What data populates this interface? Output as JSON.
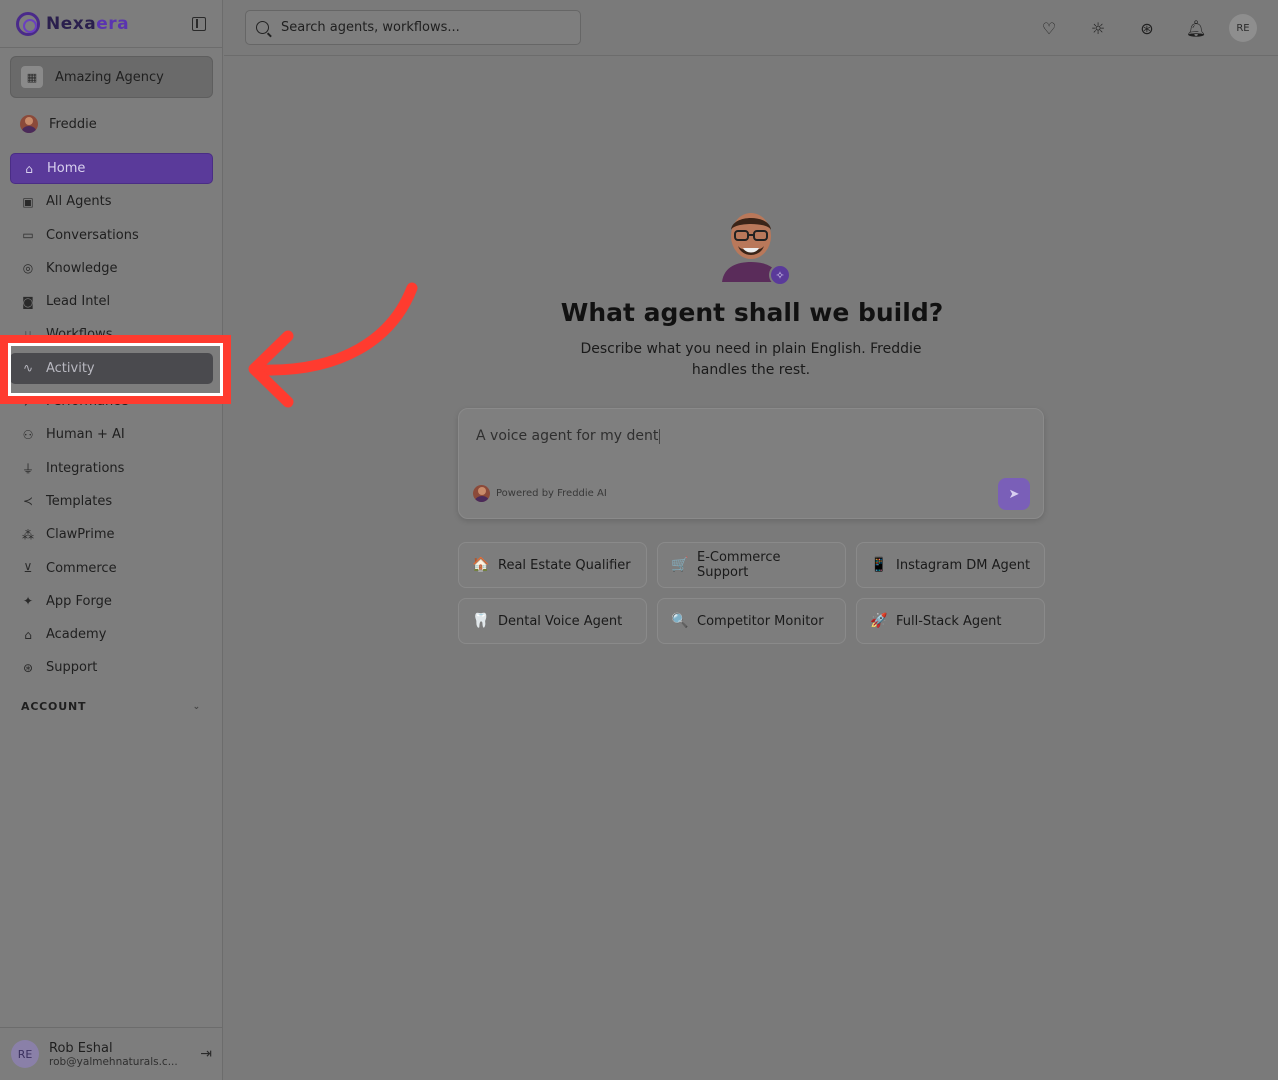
{
  "brand": {
    "name_main": "Nexa",
    "name_accent": "era"
  },
  "agency": {
    "label": "Amazing Agency"
  },
  "current_user": {
    "name": "Freddie"
  },
  "nav": {
    "items": [
      {
        "label": "Home",
        "icon": "home-icon"
      },
      {
        "label": "All Agents",
        "icon": "bot-icon"
      },
      {
        "label": "Conversations",
        "icon": "message-icon"
      },
      {
        "label": "Knowledge",
        "icon": "brain-icon"
      },
      {
        "label": "Lead Intel",
        "icon": "contact-icon"
      },
      {
        "label": "Workflows",
        "icon": "workflow-icon"
      },
      {
        "label": "Activity",
        "icon": "activity-icon"
      },
      {
        "label": "Performance",
        "icon": "trending-icon"
      },
      {
        "label": "Human + AI",
        "icon": "network-icon"
      },
      {
        "label": "Integrations",
        "icon": "plug-icon"
      },
      {
        "label": "Templates",
        "icon": "share-icon"
      },
      {
        "label": "ClawPrime",
        "icon": "cluster-icon"
      },
      {
        "label": "Commerce",
        "icon": "cart-icon"
      },
      {
        "label": "App Forge",
        "icon": "sparkles-icon"
      },
      {
        "label": "Academy",
        "icon": "graduation-icon"
      },
      {
        "label": "Support",
        "icon": "lifebuoy-icon"
      }
    ],
    "active": "Home",
    "highlighted": "Activity"
  },
  "account_section": {
    "label": "ACCOUNT"
  },
  "footer": {
    "initials": "RE",
    "name": "Rob Eshal",
    "email": "rob@yalmehnaturals.c..."
  },
  "search": {
    "placeholder": "Search agents, workflows..."
  },
  "topbar": {
    "avatar_initials": "RE"
  },
  "hero": {
    "title": "What agent shall we build?",
    "subtitle": "Describe what you need in plain English. Freddie handles the rest."
  },
  "prompt": {
    "value": "A voice agent for my dent",
    "powered_by": "Powered by Freddie AI"
  },
  "suggestions": [
    {
      "emoji": "🏠",
      "label": "Real Estate Qualifier"
    },
    {
      "emoji": "🛒",
      "label": "E-Commerce Support"
    },
    {
      "emoji": "📱",
      "label": "Instagram DM Agent"
    },
    {
      "emoji": "🦷",
      "label": "Dental Voice Agent"
    },
    {
      "emoji": "🔍",
      "label": "Competitor Monitor"
    },
    {
      "emoji": "🚀",
      "label": "Full-Stack Agent"
    }
  ],
  "colors": {
    "accent": "#5a3a9a",
    "highlight_border": "#ff3b2f",
    "overlay": "#7a7a7a"
  }
}
